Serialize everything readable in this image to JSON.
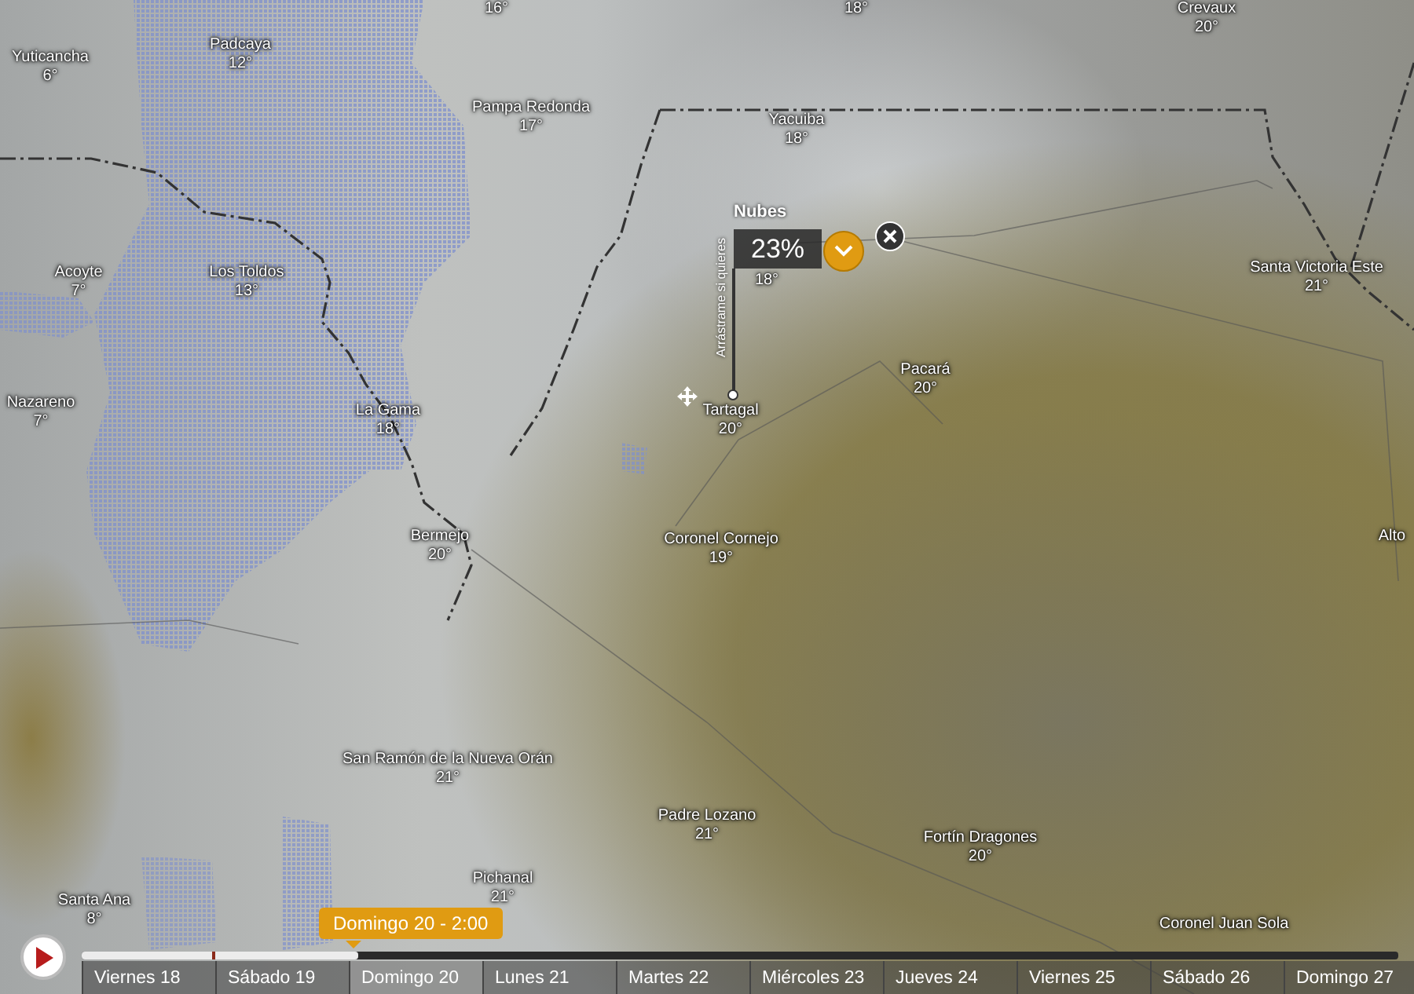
{
  "map": {
    "cities": [
      {
        "temp": "16°"
      },
      {
        "temp": "18°"
      },
      {
        "name": "Crevaux",
        "temp": "20°"
      },
      {
        "name": "Yuticancha",
        "temp": "6°"
      },
      {
        "name": "Padcaya",
        "temp": "12°"
      },
      {
        "name": "Pampa Redonda",
        "temp": "17°"
      },
      {
        "name": "Yacuiba",
        "temp": "18°"
      },
      {
        "name": "Acoyte",
        "temp": "7°"
      },
      {
        "name": "Los Toldos",
        "temp": "13°"
      },
      {
        "temp": "18°"
      },
      {
        "name": "Santa Victoria Este",
        "temp": "21°"
      },
      {
        "name": "Pacará",
        "temp": "20°"
      },
      {
        "name": "Nazareno",
        "temp": "7°"
      },
      {
        "name": "La Gama",
        "temp": "18°"
      },
      {
        "name": "Tartagal",
        "temp": "20°"
      },
      {
        "name": "Bermejo",
        "temp": "20°"
      },
      {
        "name": "Coronel Cornejo",
        "temp": "19°"
      },
      {
        "name": "Alto"
      },
      {
        "name": "San Ramón de la Nueva Orán",
        "temp": "21°"
      },
      {
        "name": "Padre Lozano",
        "temp": "21°"
      },
      {
        "name": "Fortín Dragones",
        "temp": "20°"
      },
      {
        "name": "Pichanal",
        "temp": "21°"
      },
      {
        "name": "Santa Ana",
        "temp": "8°"
      },
      {
        "name": "Coronel Juan Sola"
      }
    ]
  },
  "layer_picker": {
    "layer": "Nubes",
    "value": "23%",
    "drag_hint": "Arrástrame si quieres"
  },
  "timeline": {
    "playing": false,
    "current": "Domingo 20 - 2:00",
    "level": 0.21,
    "days": [
      {
        "label": "Viernes 18",
        "selected": false
      },
      {
        "label": "Sábado 19",
        "selected": false
      },
      {
        "label": "Domingo 20",
        "selected": true
      },
      {
        "label": "Lunes 21",
        "selected": false
      },
      {
        "label": "Martes 22",
        "selected": false
      },
      {
        "label": "Miércoles 23",
        "selected": false
      },
      {
        "label": "Jueves 24",
        "selected": false
      },
      {
        "label": "Viernes 25",
        "selected": false
      },
      {
        "label": "Sábado 26",
        "selected": false
      },
      {
        "label": "Domingo 27",
        "selected": false
      }
    ]
  }
}
